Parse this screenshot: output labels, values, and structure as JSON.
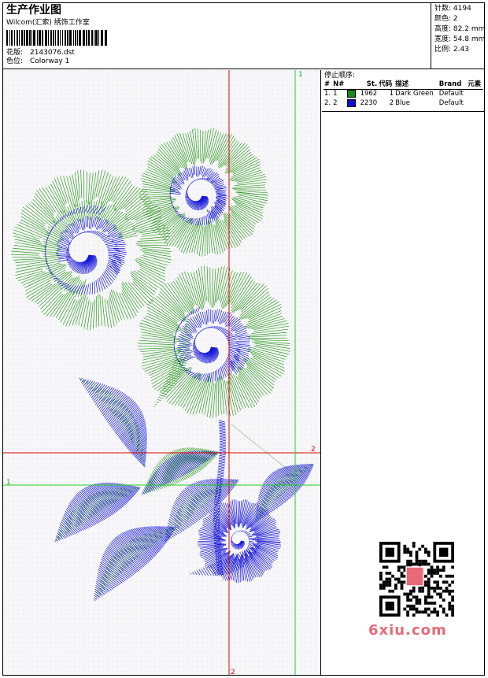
{
  "header": {
    "title": "生产作业图",
    "studio": "Wilcom(汇索) 绣饰工作室",
    "design_label": "花版:",
    "design_value": "2143076.dst",
    "colorway_label": "色位:",
    "colorway_value": "Colorway 1"
  },
  "stats": {
    "stitches_label": "针数:",
    "stitches_value": "4194",
    "colors_label": "颜色:",
    "colors_value": "2",
    "height_label": "高度:",
    "height_value": "82.2 mm",
    "width_label": "宽度:",
    "width_value": "54.8 mm",
    "scale_label": "比例:",
    "scale_value": "2.43"
  },
  "stop_sequence": {
    "title": "停止顺序:",
    "columns": [
      "#",
      "N#",
      "St.",
      "代码",
      "描述",
      "Brand",
      "元素"
    ],
    "rows": [
      {
        "idx": "1.",
        "n": "1",
        "color": "#1a8a1a",
        "st": "1962",
        "code": "1",
        "desc": "Dark Green",
        "brand": "Default",
        "elem": ""
      },
      {
        "idx": "2.",
        "n": "2",
        "color": "#1010cc",
        "st": "2230",
        "code": "2",
        "desc": "Blue",
        "brand": "Default",
        "elem": ""
      }
    ]
  },
  "guides": {
    "green_top": "1",
    "green_left": "1",
    "red_right": "2",
    "red_bottom": "2"
  },
  "colors": {
    "green_thread": "#2e9a1e",
    "blue_thread": "#1515d8",
    "guide_red": "#e00000",
    "guide_green": "#22cc22"
  },
  "watermark": {
    "text": "6xiu.com",
    "seal": "双丽图库"
  }
}
